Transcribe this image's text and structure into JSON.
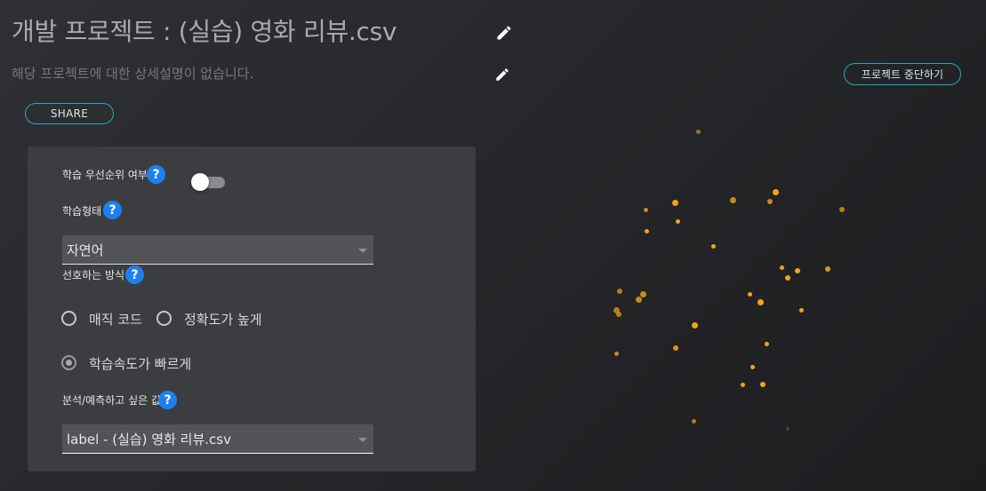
{
  "header": {
    "title": "개발 프로젝트 : (실습) 영화 리뷰.csv",
    "description": "해당 프로젝트에 대한 상세설명이 없습니다.",
    "share_label": "SHARE",
    "stop_label": "프로젝트 중단하기"
  },
  "form": {
    "priority_label": "학습 우선순위 여부",
    "priority_enabled": false,
    "learning_type_label": "학습형태",
    "learning_type_value": "자연어",
    "preferred_method_label": "선호하는 방식",
    "method_options": [
      {
        "label": "매직 코드",
        "selected": false
      },
      {
        "label": "정확도가 높게",
        "selected": false
      },
      {
        "label": "학습속도가 빠르게",
        "selected": true
      }
    ],
    "target_label": "분석/예측하고 싶은 값",
    "target_value": "label - (실습) 영화 리뷰.csv"
  },
  "icons": {
    "help": "?",
    "edit": "pencil-icon",
    "dropdown": "chevron-down-icon"
  },
  "colors": {
    "accent": "#2aa6c4",
    "help": "#1f7ff2",
    "particle": "#f5a31a"
  }
}
